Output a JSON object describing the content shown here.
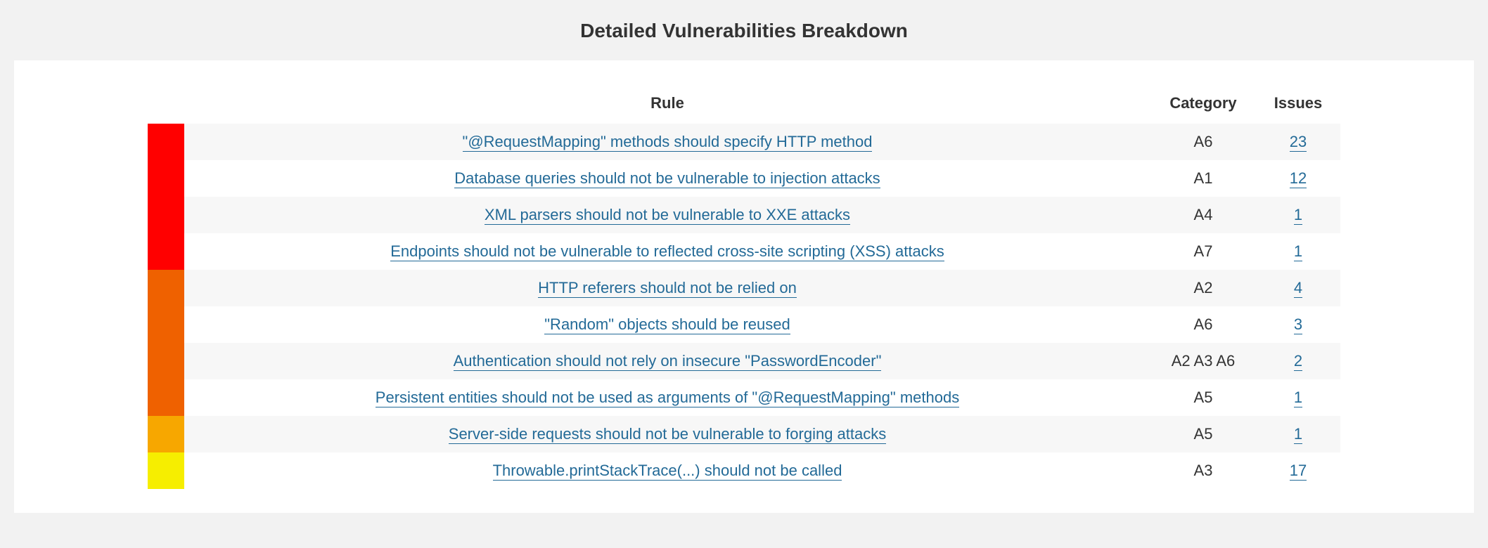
{
  "title": "Detailed Vulnerabilities Breakdown",
  "headers": {
    "rule": "Rule",
    "category": "Category",
    "issues": "Issues"
  },
  "severity_colors": {
    "blocker": "#ff0000",
    "critical": "#ef6100",
    "major": "#f7a700",
    "minor": "#f6ee00"
  },
  "rows": [
    {
      "severity": "blocker",
      "rule": "\"@RequestMapping\" methods should specify HTTP method",
      "category": "A6",
      "issues": 23
    },
    {
      "severity": "blocker",
      "rule": "Database queries should not be vulnerable to injection attacks",
      "category": "A1",
      "issues": 12
    },
    {
      "severity": "blocker",
      "rule": "XML parsers should not be vulnerable to XXE attacks",
      "category": "A4",
      "issues": 1
    },
    {
      "severity": "blocker",
      "rule": "Endpoints should not be vulnerable to reflected cross-site scripting (XSS) attacks",
      "category": "A7",
      "issues": 1
    },
    {
      "severity": "critical",
      "rule": "HTTP referers should not be relied on",
      "category": "A2",
      "issues": 4
    },
    {
      "severity": "critical",
      "rule": "\"Random\" objects should be reused",
      "category": "A6",
      "issues": 3
    },
    {
      "severity": "critical",
      "rule": "Authentication should not rely on insecure \"PasswordEncoder\"",
      "category": "A2 A3 A6",
      "issues": 2
    },
    {
      "severity": "critical",
      "rule": "Persistent entities should not be used as arguments of \"@RequestMapping\" methods",
      "category": "A5",
      "issues": 1
    },
    {
      "severity": "major",
      "rule": "Server-side requests should not be vulnerable to forging attacks",
      "category": "A5",
      "issues": 1
    },
    {
      "severity": "minor",
      "rule": "Throwable.printStackTrace(...) should not be called",
      "category": "A3",
      "issues": 17
    }
  ]
}
